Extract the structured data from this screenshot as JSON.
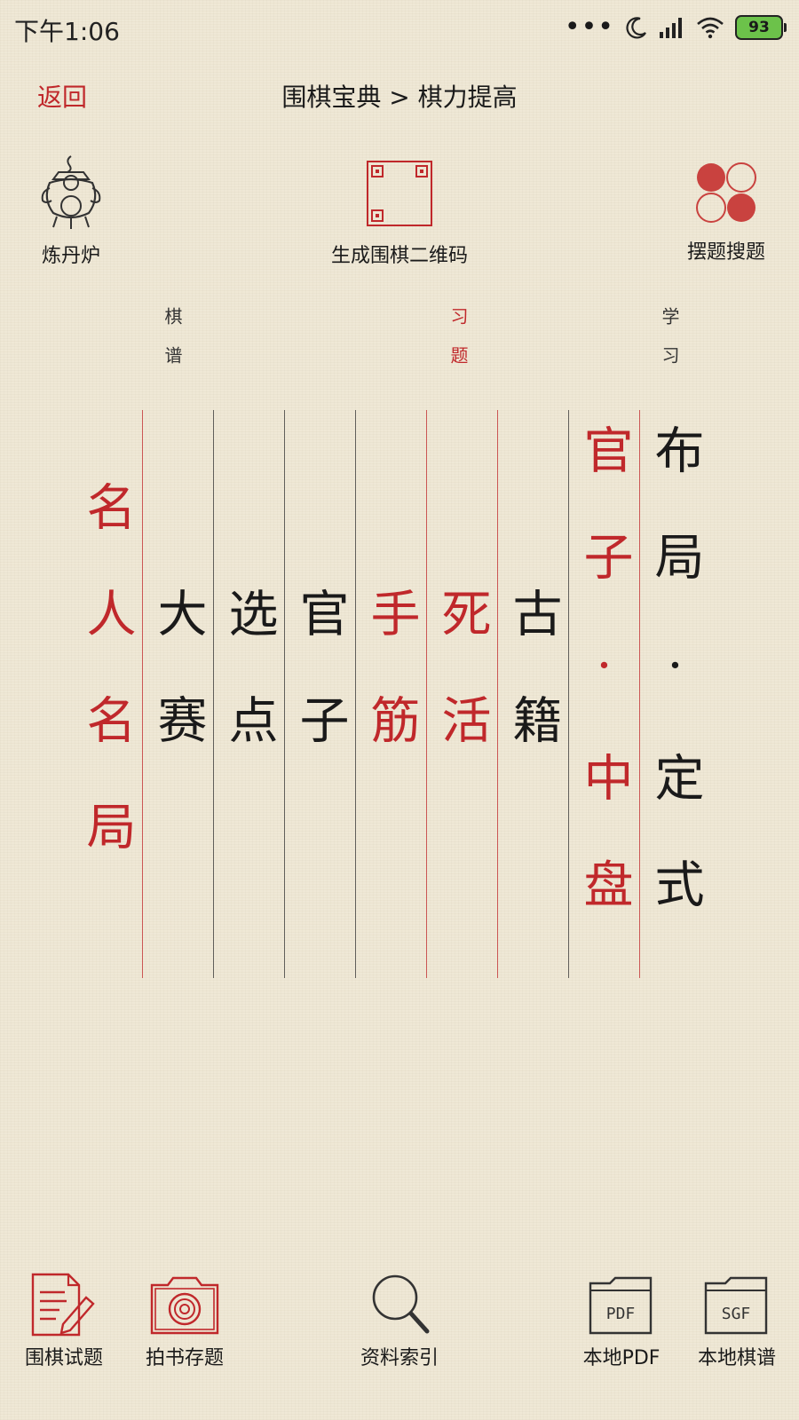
{
  "status_bar": {
    "time": "下午1:06",
    "battery": "93"
  },
  "header": {
    "back_label": "返回",
    "title": "围棋宝典 > 棋力提高"
  },
  "tools": {
    "left_label": "炼丹炉",
    "center_label": "生成围棋二维码",
    "right_label": "摆题搜题"
  },
  "menu": {
    "group_labels": {
      "qipu": "棋谱",
      "xiti": "习题",
      "xuexi": "学习"
    },
    "columns": [
      {
        "text": "名人名局",
        "color": "#c0282b"
      },
      {
        "text": "大赛",
        "color": "#1a1a1a"
      },
      {
        "text": "选点",
        "color": "#1a1a1a"
      },
      {
        "text": "官子",
        "color": "#1a1a1a"
      },
      {
        "text": "手筋",
        "color": "#c0282b"
      },
      {
        "text": "死活",
        "color": "#c0282b"
      },
      {
        "text": "古籍",
        "color": "#1a1a1a"
      },
      {
        "text": "官子·中盘",
        "color": "#c0282b"
      },
      {
        "text": "布局·定式",
        "color": "#1a1a1a"
      }
    ]
  },
  "bottom_bar": {
    "items": [
      {
        "label": "围棋试题"
      },
      {
        "label": "拍书存题"
      },
      {
        "label": "资料索引"
      },
      {
        "label": "本地PDF",
        "badge": "PDF"
      },
      {
        "label": "本地棋谱",
        "badge": "SGF"
      }
    ]
  },
  "colors": {
    "accent": "#c0282b",
    "text": "#1a1a1a",
    "background": "#efe8d6"
  }
}
